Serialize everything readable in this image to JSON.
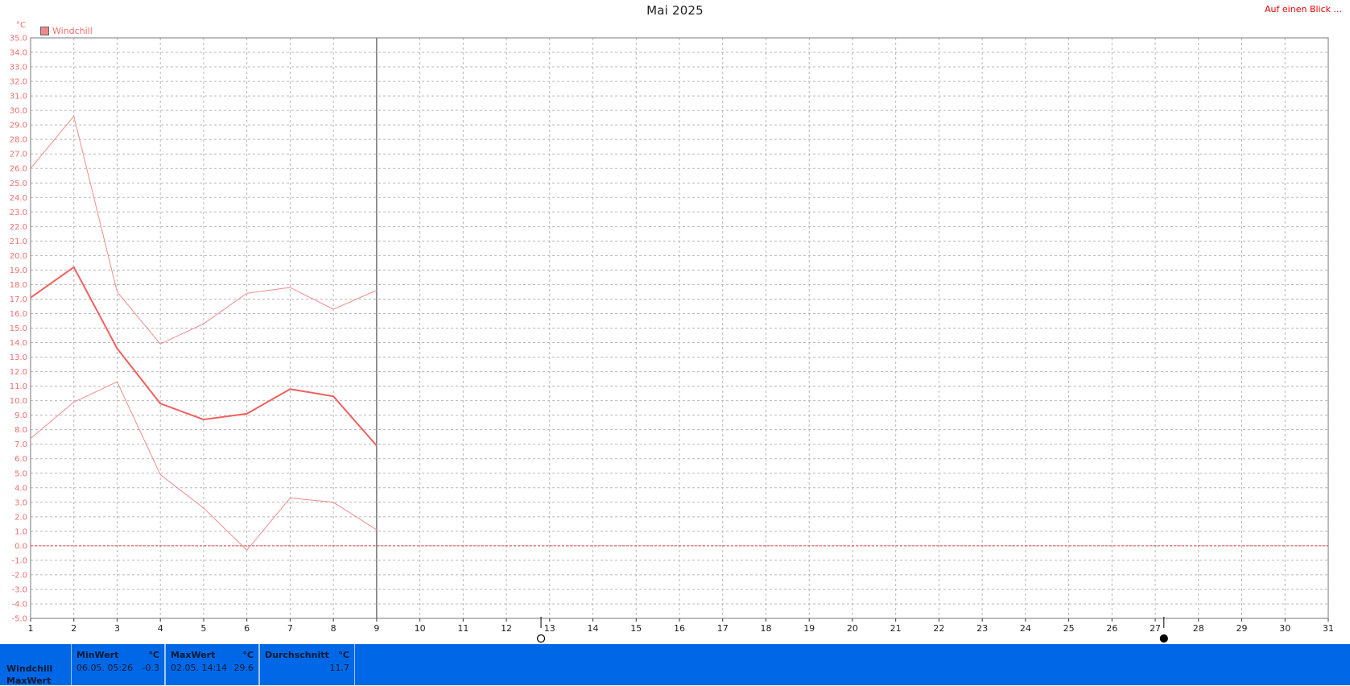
{
  "header": {
    "title": "Mai 2025",
    "overview_link": "Auf einen Blick ..."
  },
  "legend": {
    "label": "Windchill",
    "color": "#ef8a8a"
  },
  "chart_data": {
    "type": "line",
    "title": "Mai 2025",
    "ylabel": "°C",
    "ylim": [
      -5.0,
      35.0
    ],
    "ytick_step": 1.0,
    "xlim": [
      1,
      31
    ],
    "x_ticks": [
      1,
      2,
      3,
      4,
      5,
      6,
      7,
      8,
      9,
      10,
      11,
      12,
      13,
      14,
      15,
      16,
      17,
      18,
      19,
      20,
      21,
      22,
      23,
      24,
      25,
      26,
      27,
      28,
      29,
      30,
      31
    ],
    "current_day_marker": 9,
    "zero_line": 0.0,
    "grid": true,
    "moon_phases": [
      {
        "day": 12.8,
        "phase": "first-quarter"
      },
      {
        "day": 27.2,
        "phase": "new-moon"
      }
    ],
    "series": [
      {
        "name": "Windchill",
        "role": "max",
        "color": "#f08c8c",
        "width": 1,
        "x": [
          1,
          2,
          3,
          4,
          5,
          6,
          7,
          8,
          9
        ],
        "values": [
          26.0,
          29.6,
          17.5,
          13.9,
          15.3,
          17.4,
          17.8,
          16.3,
          17.6
        ]
      },
      {
        "name": "Windchill",
        "role": "avg",
        "color": "#f06060",
        "width": 2,
        "x": [
          1,
          2,
          3,
          4,
          5,
          6,
          7,
          8,
          9
        ],
        "values": [
          17.1,
          19.2,
          13.6,
          9.8,
          8.7,
          9.1,
          10.8,
          10.3,
          6.9
        ]
      },
      {
        "name": "Windchill",
        "role": "min",
        "color": "#f08c8c",
        "width": 1,
        "x": [
          1,
          2,
          3,
          4,
          5,
          6,
          7,
          8,
          9
        ],
        "values": [
          7.4,
          9.9,
          11.3,
          4.9,
          2.6,
          -0.3,
          3.3,
          3.0,
          1.1
        ]
      }
    ]
  },
  "stats": {
    "row_label": "Windchill",
    "row_label2": "MaxWert",
    "min": {
      "header": "MinWert",
      "unit": "°C",
      "date": "06.05.  05:26",
      "value": "-0.3"
    },
    "max": {
      "header": "MaxWert",
      "unit": "°C",
      "date": "02.05.  14:14",
      "value": "29.6"
    },
    "avg": {
      "header": "Durchschnitt",
      "unit": "°C",
      "value": "11.7"
    }
  },
  "colors": {
    "axis_text": "#ef6f6f",
    "grid": "#b8b8b8",
    "panel_bg": "#0068e6"
  }
}
